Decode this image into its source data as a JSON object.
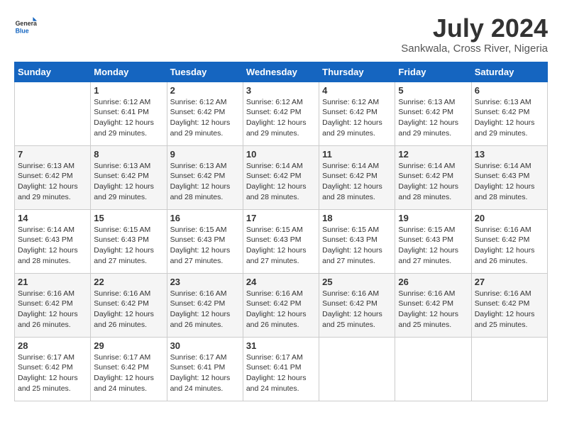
{
  "logo": {
    "general": "General",
    "blue": "Blue"
  },
  "header": {
    "month": "July 2024",
    "location": "Sankwala, Cross River, Nigeria"
  },
  "weekdays": [
    "Sunday",
    "Monday",
    "Tuesday",
    "Wednesday",
    "Thursday",
    "Friday",
    "Saturday"
  ],
  "weeks": [
    [
      {
        "day": "",
        "info": ""
      },
      {
        "day": "1",
        "info": "Sunrise: 6:12 AM\nSunset: 6:41 PM\nDaylight: 12 hours\nand 29 minutes."
      },
      {
        "day": "2",
        "info": "Sunrise: 6:12 AM\nSunset: 6:42 PM\nDaylight: 12 hours\nand 29 minutes."
      },
      {
        "day": "3",
        "info": "Sunrise: 6:12 AM\nSunset: 6:42 PM\nDaylight: 12 hours\nand 29 minutes."
      },
      {
        "day": "4",
        "info": "Sunrise: 6:12 AM\nSunset: 6:42 PM\nDaylight: 12 hours\nand 29 minutes."
      },
      {
        "day": "5",
        "info": "Sunrise: 6:13 AM\nSunset: 6:42 PM\nDaylight: 12 hours\nand 29 minutes."
      },
      {
        "day": "6",
        "info": "Sunrise: 6:13 AM\nSunset: 6:42 PM\nDaylight: 12 hours\nand 29 minutes."
      }
    ],
    [
      {
        "day": "7",
        "info": "Sunrise: 6:13 AM\nSunset: 6:42 PM\nDaylight: 12 hours\nand 29 minutes."
      },
      {
        "day": "8",
        "info": "Sunrise: 6:13 AM\nSunset: 6:42 PM\nDaylight: 12 hours\nand 29 minutes."
      },
      {
        "day": "9",
        "info": "Sunrise: 6:13 AM\nSunset: 6:42 PM\nDaylight: 12 hours\nand 28 minutes."
      },
      {
        "day": "10",
        "info": "Sunrise: 6:14 AM\nSunset: 6:42 PM\nDaylight: 12 hours\nand 28 minutes."
      },
      {
        "day": "11",
        "info": "Sunrise: 6:14 AM\nSunset: 6:42 PM\nDaylight: 12 hours\nand 28 minutes."
      },
      {
        "day": "12",
        "info": "Sunrise: 6:14 AM\nSunset: 6:42 PM\nDaylight: 12 hours\nand 28 minutes."
      },
      {
        "day": "13",
        "info": "Sunrise: 6:14 AM\nSunset: 6:43 PM\nDaylight: 12 hours\nand 28 minutes."
      }
    ],
    [
      {
        "day": "14",
        "info": "Sunrise: 6:14 AM\nSunset: 6:43 PM\nDaylight: 12 hours\nand 28 minutes."
      },
      {
        "day": "15",
        "info": "Sunrise: 6:15 AM\nSunset: 6:43 PM\nDaylight: 12 hours\nand 27 minutes."
      },
      {
        "day": "16",
        "info": "Sunrise: 6:15 AM\nSunset: 6:43 PM\nDaylight: 12 hours\nand 27 minutes."
      },
      {
        "day": "17",
        "info": "Sunrise: 6:15 AM\nSunset: 6:43 PM\nDaylight: 12 hours\nand 27 minutes."
      },
      {
        "day": "18",
        "info": "Sunrise: 6:15 AM\nSunset: 6:43 PM\nDaylight: 12 hours\nand 27 minutes."
      },
      {
        "day": "19",
        "info": "Sunrise: 6:15 AM\nSunset: 6:43 PM\nDaylight: 12 hours\nand 27 minutes."
      },
      {
        "day": "20",
        "info": "Sunrise: 6:16 AM\nSunset: 6:42 PM\nDaylight: 12 hours\nand 26 minutes."
      }
    ],
    [
      {
        "day": "21",
        "info": "Sunrise: 6:16 AM\nSunset: 6:42 PM\nDaylight: 12 hours\nand 26 minutes."
      },
      {
        "day": "22",
        "info": "Sunrise: 6:16 AM\nSunset: 6:42 PM\nDaylight: 12 hours\nand 26 minutes."
      },
      {
        "day": "23",
        "info": "Sunrise: 6:16 AM\nSunset: 6:42 PM\nDaylight: 12 hours\nand 26 minutes."
      },
      {
        "day": "24",
        "info": "Sunrise: 6:16 AM\nSunset: 6:42 PM\nDaylight: 12 hours\nand 26 minutes."
      },
      {
        "day": "25",
        "info": "Sunrise: 6:16 AM\nSunset: 6:42 PM\nDaylight: 12 hours\nand 25 minutes."
      },
      {
        "day": "26",
        "info": "Sunrise: 6:16 AM\nSunset: 6:42 PM\nDaylight: 12 hours\nand 25 minutes."
      },
      {
        "day": "27",
        "info": "Sunrise: 6:16 AM\nSunset: 6:42 PM\nDaylight: 12 hours\nand 25 minutes."
      }
    ],
    [
      {
        "day": "28",
        "info": "Sunrise: 6:17 AM\nSunset: 6:42 PM\nDaylight: 12 hours\nand 25 minutes."
      },
      {
        "day": "29",
        "info": "Sunrise: 6:17 AM\nSunset: 6:42 PM\nDaylight: 12 hours\nand 24 minutes."
      },
      {
        "day": "30",
        "info": "Sunrise: 6:17 AM\nSunset: 6:41 PM\nDaylight: 12 hours\nand 24 minutes."
      },
      {
        "day": "31",
        "info": "Sunrise: 6:17 AM\nSunset: 6:41 PM\nDaylight: 12 hours\nand 24 minutes."
      },
      {
        "day": "",
        "info": ""
      },
      {
        "day": "",
        "info": ""
      },
      {
        "day": "",
        "info": ""
      }
    ]
  ]
}
